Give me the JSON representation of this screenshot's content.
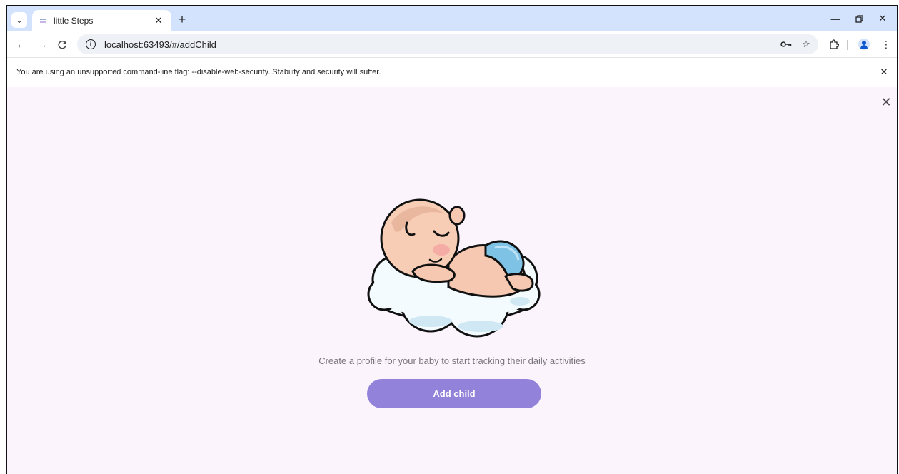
{
  "browser": {
    "tab": {
      "title": "little Steps",
      "favicon": "app-icon"
    },
    "new_tab_label": "+",
    "address_bar": {
      "url": "localhost:63493/#/addChild"
    },
    "infobar": {
      "message": "You are using an unsupported command-line flag: --disable-web-security. Stability and security will suffer."
    }
  },
  "page": {
    "tagline": "Create a profile for your baby to start tracking their daily activities",
    "add_child_label": "Add child",
    "accent_color": "#9282d9",
    "background_color": "#fbf4fd"
  }
}
